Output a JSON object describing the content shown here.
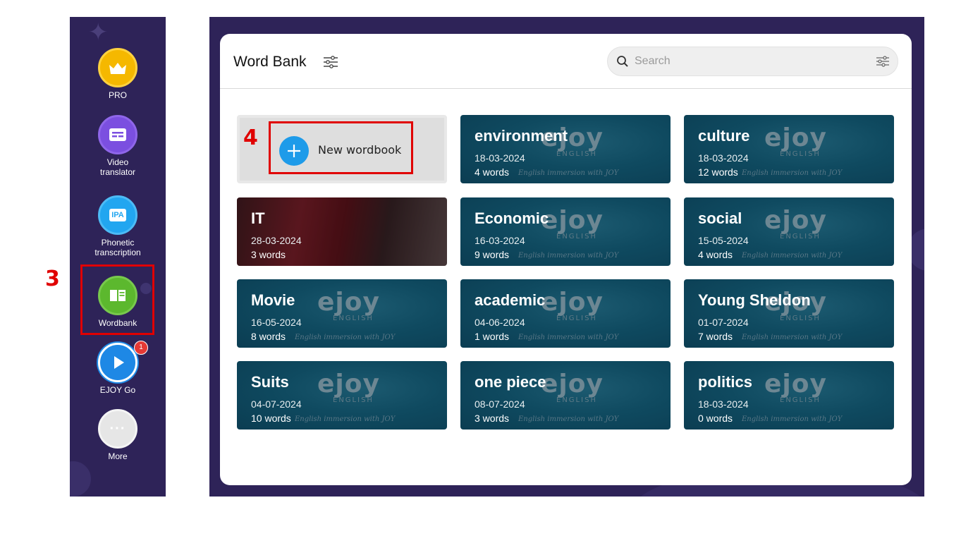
{
  "sidebar": {
    "items": [
      {
        "label": "PRO",
        "icon": "crown-icon"
      },
      {
        "label_line1": "Video",
        "label_line2": "translator",
        "icon": "subtitles-icon"
      },
      {
        "label_line1": "Phonetic",
        "label_line2": "transcription",
        "icon": "ipa-icon",
        "icon_text": "IPA"
      },
      {
        "label": "Wordbank",
        "icon": "book-icon"
      },
      {
        "label": "EJOY Go",
        "icon": "play-icon",
        "badge": "1"
      },
      {
        "label": "More",
        "icon": "more-icon",
        "icon_text": "···"
      }
    ]
  },
  "annotations": {
    "step3": "3",
    "step4": "4"
  },
  "header": {
    "title": "Word Bank",
    "search_placeholder": "Search"
  },
  "new_wordbook": {
    "label": "New wordbook"
  },
  "logo": {
    "word": "ejoy",
    "sub": "ENGLISH",
    "tagline": "English immersion with JOY"
  },
  "wordbooks": [
    {
      "name": "environment",
      "date": "18-03-2024",
      "count": "4 words"
    },
    {
      "name": "culture",
      "date": "18-03-2024",
      "count": "12 words"
    },
    {
      "name": "IT",
      "date": "28-03-2024",
      "count": "3 words"
    },
    {
      "name": "Economic",
      "date": "16-03-2024",
      "count": "9 words"
    },
    {
      "name": "social",
      "date": "15-05-2024",
      "count": "4 words"
    },
    {
      "name": "Movie",
      "date": "16-05-2024",
      "count": "8 words"
    },
    {
      "name": "academic",
      "date": "04-06-2024",
      "count": "1 words"
    },
    {
      "name": "Young Sheldon",
      "date": "01-07-2024",
      "count": "7 words"
    },
    {
      "name": "Suits",
      "date": "04-07-2024",
      "count": "10 words"
    },
    {
      "name": "one piece",
      "date": "08-07-2024",
      "count": "3 words"
    },
    {
      "name": "politics",
      "date": "18-03-2024",
      "count": "0 words"
    }
  ],
  "colors": {
    "sidebar_bg": "#2e2358",
    "card_bg": "#0f4a60",
    "highlight": "#e00000",
    "accent_blue": "#1e9be9"
  }
}
